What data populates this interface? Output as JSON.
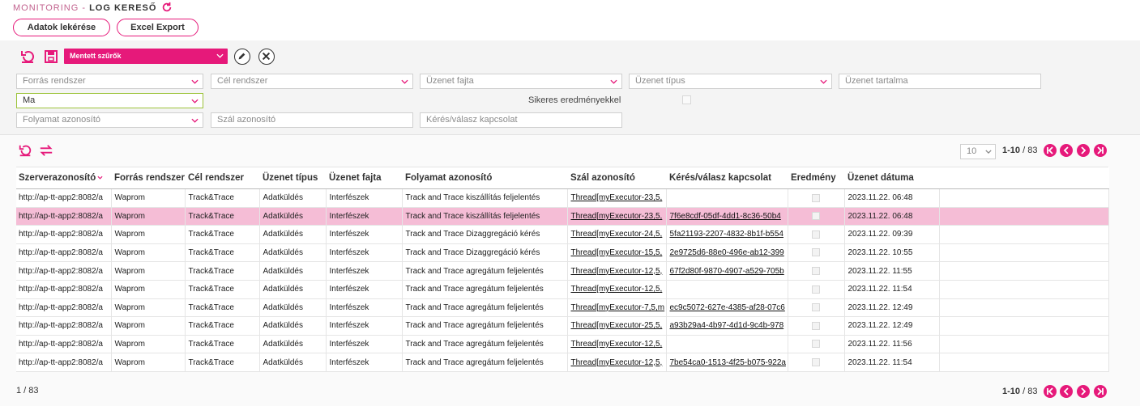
{
  "breadcrumb": {
    "section": "MONITORING -",
    "page": "LOG KERESŐ"
  },
  "toolbar": {
    "fetch_label": "Adatok lekérése",
    "export_label": "Excel Export"
  },
  "filters": {
    "saved_filters": "Mentett szűrők",
    "source_system": "Forrás rendszer",
    "target_system": "Cél rendszer",
    "message_kind": "Üzenet fajta",
    "message_type": "Üzenet típus",
    "message_content": "Üzenet tartalma",
    "date_range": "Ma",
    "success_label": "Sikeres eredményekkel",
    "process_id": "Folyamat azonosító",
    "thread_id": "Szál azonosító",
    "request_response": "Kérés/válasz kapcsolat"
  },
  "pager": {
    "page_size": "10",
    "range_bold": "1-10",
    "range_total": " / 83"
  },
  "footer": {
    "count": "1  /  83"
  },
  "table": {
    "columns": [
      "Szerverazonosító",
      "Forrás rendszer",
      "Cél rendszer",
      "Üzenet típus",
      "Üzenet fajta",
      "Folyamat azonosító",
      "Szál azonosító",
      "Kérés/válasz kapcsolat",
      "Eredmény",
      "Üzenet dátuma"
    ],
    "rows": [
      [
        "http://ap-tt-app2:8082/a",
        "Waprom",
        "Track&Trace",
        "Adatküldés",
        "Interfészek",
        "Track and Trace kiszállítás feljelentés",
        "Thread[myExecutor-23,5,",
        "",
        "2023.11.22. 06:48"
      ],
      [
        "http://ap-tt-app2:8082/a",
        "Waprom",
        "Track&Trace",
        "Adatküldés",
        "Interfészek",
        "Track and Trace kiszállítás feljelentés",
        "Thread[myExecutor-23,5,",
        "7f6e8cdf-05df-4dd1-8c36-50b4",
        "2023.11.22. 06:48"
      ],
      [
        "http://ap-tt-app2:8082/a",
        "Waprom",
        "Track&Trace",
        "Adatküldés",
        "Interfészek",
        "Track and Trace Dizaggregáció kérés",
        "Thread[myExecutor-24,5,",
        "5fa21193-2207-4832-8b1f-b554",
        "2023.11.22. 09:39"
      ],
      [
        "http://ap-tt-app2:8082/a",
        "Waprom",
        "Track&Trace",
        "Adatküldés",
        "Interfészek",
        "Track and Trace Dizaggregáció kérés",
        "Thread[myExecutor-15,5,",
        "2e9725d6-88e0-496e-ab12-399",
        "2023.11.22. 10:55"
      ],
      [
        "http://ap-tt-app2:8082/a",
        "Waprom",
        "Track&Trace",
        "Adatküldés",
        "Interfészek",
        "Track and Trace agregátum feljelentés",
        "Thread[myExecutor-12,5,",
        "67f2d80f-9870-4907-a529-705b",
        "2023.11.22. 11:55"
      ],
      [
        "http://ap-tt-app2:8082/a",
        "Waprom",
        "Track&Trace",
        "Adatküldés",
        "Interfészek",
        "Track and Trace agregátum feljelentés",
        "Thread[myExecutor-12,5,",
        "",
        "2023.11.22. 11:54"
      ],
      [
        "http://ap-tt-app2:8082/a",
        "Waprom",
        "Track&Trace",
        "Adatküldés",
        "Interfészek",
        "Track and Trace agregátum feljelentés",
        "Thread[myExecutor-7,5,m",
        "ec9c5072-627e-4385-af28-07c6",
        "2023.11.22. 12:49"
      ],
      [
        "http://ap-tt-app2:8082/a",
        "Waprom",
        "Track&Trace",
        "Adatküldés",
        "Interfészek",
        "Track and Trace agregátum feljelentés",
        "Thread[myExecutor-25,5,",
        "a93b29a4-4b97-4d1d-9c4b-978",
        "2023.11.22. 12:49"
      ],
      [
        "http://ap-tt-app2:8082/a",
        "Waprom",
        "Track&Trace",
        "Adatküldés",
        "Interfészek",
        "Track and Trace agregátum feljelentés",
        "Thread[myExecutor-12,5,",
        "",
        "2023.11.22. 11:56"
      ],
      [
        "http://ap-tt-app2:8082/a",
        "Waprom",
        "Track&Trace",
        "Adatküldés",
        "Interfészek",
        "Track and Trace agregátum feljelentés",
        "Thread[myExecutor-12,5,",
        "7be54ca0-1513-4f25-b075-922a",
        "2023.11.22. 11:54"
      ]
    ],
    "selected_row": 1
  },
  "colors": {
    "accent": "#e6197a",
    "selected_row": "#f5bdd6",
    "active_border": "#9cc33a"
  }
}
